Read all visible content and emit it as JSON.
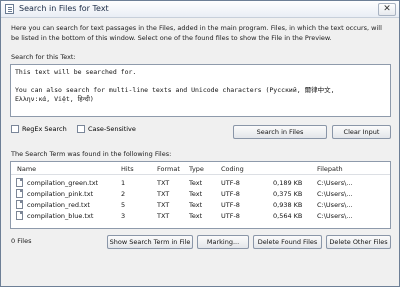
{
  "window": {
    "title": "Search in Files for Text",
    "close_glyph": "✕"
  },
  "intro": "Here you can search for text passages in the Files, added in the main program. Files, in which the text occurs, will be listed in the bottom of this window. Select one of the found files to show the File in the Preview.",
  "search": {
    "label": "Search for this Text:",
    "lines": [
      "This text will be searched for.",
      "",
      "You can also search for multi-line texts and Unicode characters (Русский, 爾律中文,",
      "Ελλην:κά, Việt, हिन्दी)"
    ]
  },
  "options": {
    "regex_label": "RegEx Search",
    "case_label": "Case-Sensitive"
  },
  "buttons": {
    "search": "Search in Files",
    "clear": "Clear Input",
    "show_term": "Show Search Term in File",
    "marking": "Marking...",
    "delete_found": "Delete Found Files",
    "delete_other": "Delete Other Files"
  },
  "results": {
    "label": "The Search Term was found in the following Files:",
    "columns": [
      "Name",
      "Hits",
      "Format",
      "Type",
      "Coding",
      "Filepath"
    ],
    "rows": [
      {
        "name": "compilation_green.txt",
        "hits": "1",
        "format": "TXT",
        "type": "Text",
        "coding": "UTF-8",
        "size": "0,189 KB",
        "path": "C:\\Users\\..."
      },
      {
        "name": "compilation_pink.txt",
        "hits": "2",
        "format": "TXT",
        "type": "Text",
        "coding": "UTF-8",
        "size": "0,375 KB",
        "path": "C:\\Users\\..."
      },
      {
        "name": "compilation_red.txt",
        "hits": "5",
        "format": "TXT",
        "type": "Text",
        "coding": "UTF-8",
        "size": "0,938 KB",
        "path": "C:\\Users\\..."
      },
      {
        "name": "compilation_blue.txt",
        "hits": "3",
        "format": "TXT",
        "type": "Text",
        "coding": "UTF-8",
        "size": "0,564 KB",
        "path": "C:\\Users\\..."
      }
    ]
  },
  "status": {
    "files_count": "0 Files"
  }
}
